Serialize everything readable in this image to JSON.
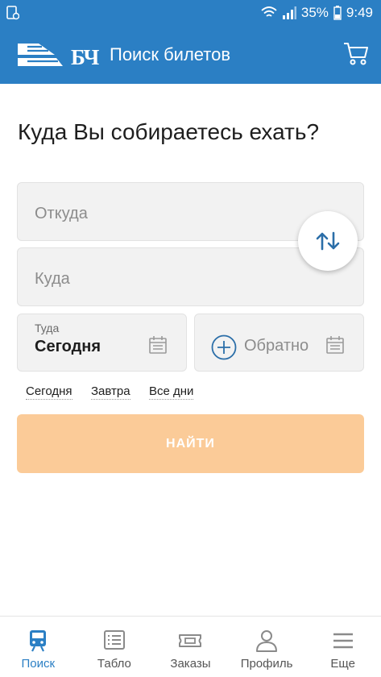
{
  "status_bar": {
    "battery": "35%",
    "time": "9:49",
    "icons": [
      "notification-icon",
      "wifi-icon",
      "signal-icon",
      "battery-icon"
    ]
  },
  "app_bar": {
    "logo_text": "БЧ",
    "title": "Поиск билетов",
    "cart_icon": "cart-icon"
  },
  "heading": "Куда Вы собираетесь ехать?",
  "form": {
    "from_placeholder": "Откуда",
    "to_placeholder": "Куда",
    "swap_icon": "swap-arrows-icon",
    "date_there_label": "Туда",
    "date_there_value": "Сегодня",
    "date_back_label": "Обратно",
    "quick_dates": [
      "Сегодня",
      "Завтра",
      "Все дни"
    ],
    "find_label": "НАЙТИ"
  },
  "bottom_nav": [
    {
      "label": "Поиск",
      "icon": "train-icon",
      "active": true
    },
    {
      "label": "Табло",
      "icon": "board-icon",
      "active": false
    },
    {
      "label": "Заказы",
      "icon": "ticket-icon",
      "active": false
    },
    {
      "label": "Профиль",
      "icon": "person-icon",
      "active": false
    },
    {
      "label": "Еще",
      "icon": "menu-icon",
      "active": false
    }
  ],
  "colors": {
    "primary": "#2b7fc4",
    "button_disabled": "#fbcb98",
    "field_bg": "#f2f2f2"
  }
}
